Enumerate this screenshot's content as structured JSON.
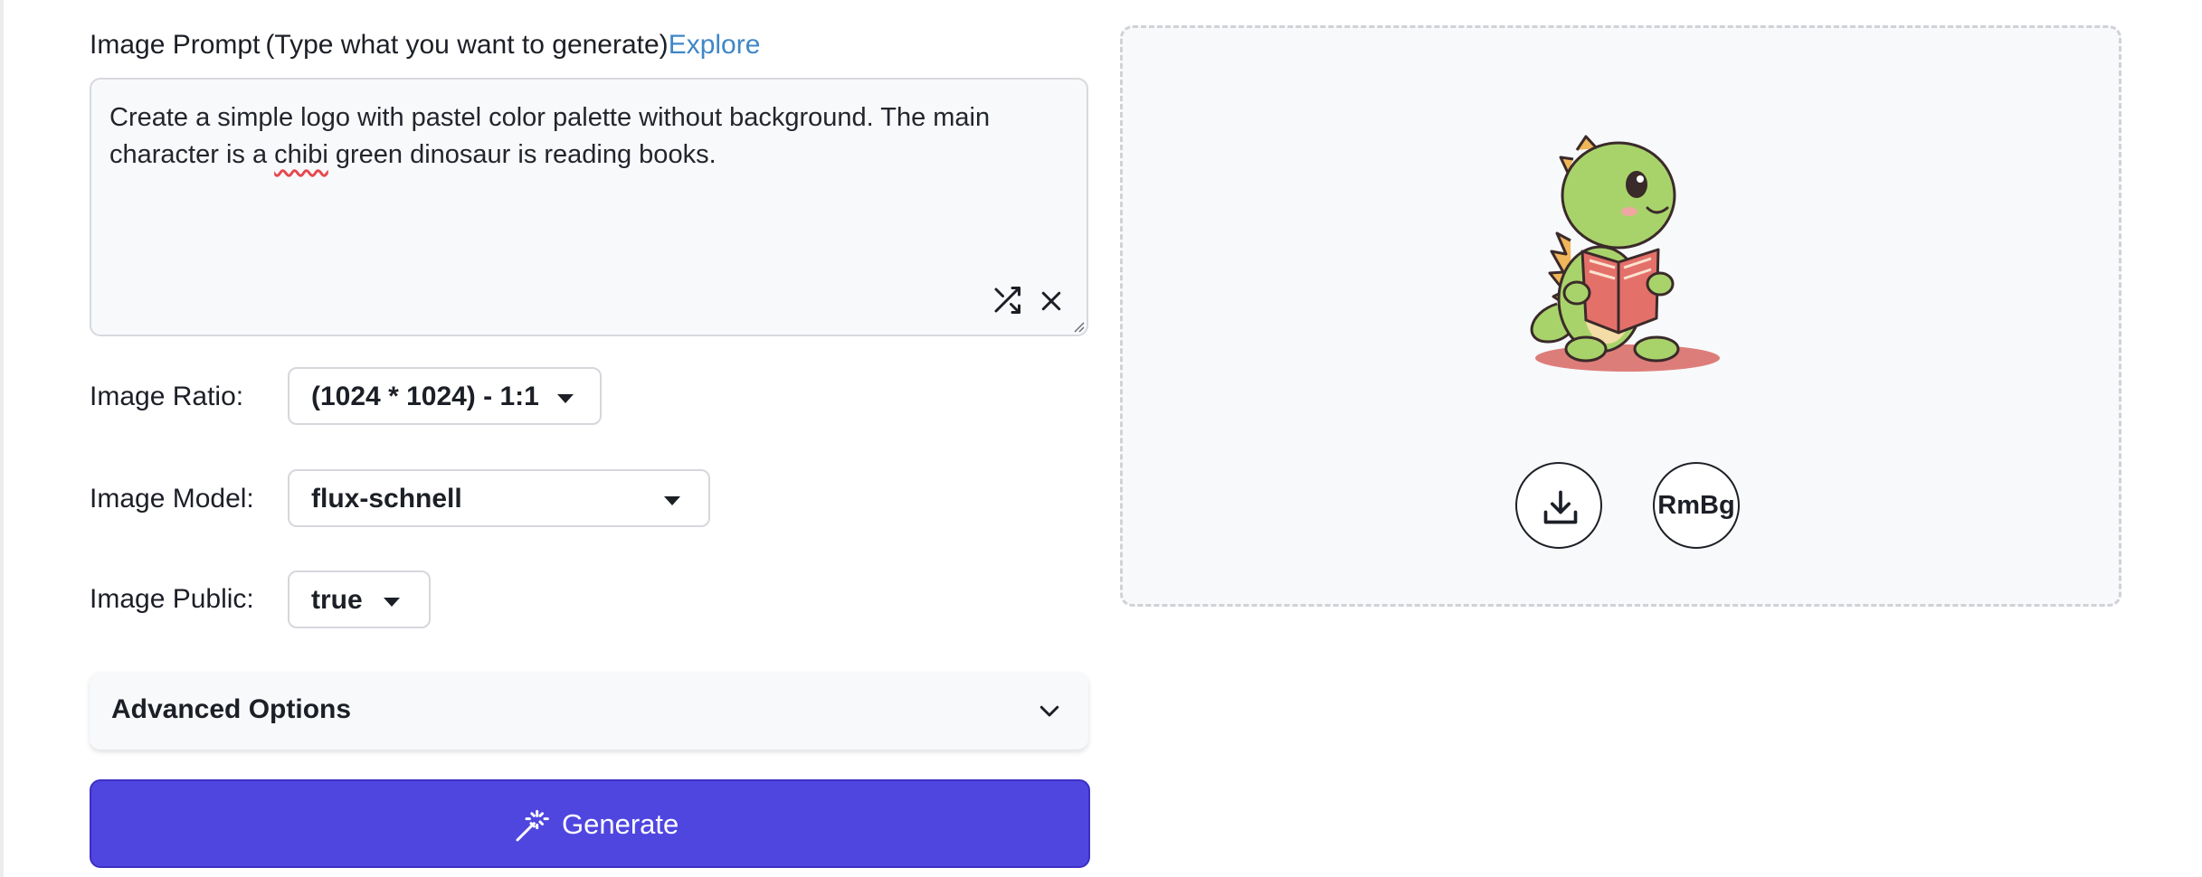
{
  "prompt": {
    "label": "Image Prompt",
    "hint": "(Type what you want to generate)",
    "explore_link": "Explore",
    "text_before": "Create a simple logo with pastel color palette without background. The main character is a ",
    "text_flagged": "chibi",
    "text_after": " green dinosaur is reading books."
  },
  "ratio": {
    "label": "Image Ratio:",
    "value": "(1024 * 1024) - 1:1"
  },
  "model": {
    "label": "Image Model:",
    "value": "flux-schnell"
  },
  "public": {
    "label": "Image Public:",
    "value": "true"
  },
  "advanced": {
    "label": "Advanced Options"
  },
  "generate": {
    "label": "Generate"
  },
  "preview": {
    "rmbg_label": "RmBg"
  },
  "icons": {
    "shuffle": "shuffle-icon",
    "clear": "close-icon",
    "advanced_toggle": "chevron-down-icon",
    "generate": "magic-wand-icon",
    "download": "download-icon"
  },
  "colors": {
    "accent": "#4f46e0",
    "link": "#3f87c7",
    "panel_bg": "#f8f9fb",
    "border": "#d5d7dc",
    "spellcheck": "#e5484d"
  }
}
